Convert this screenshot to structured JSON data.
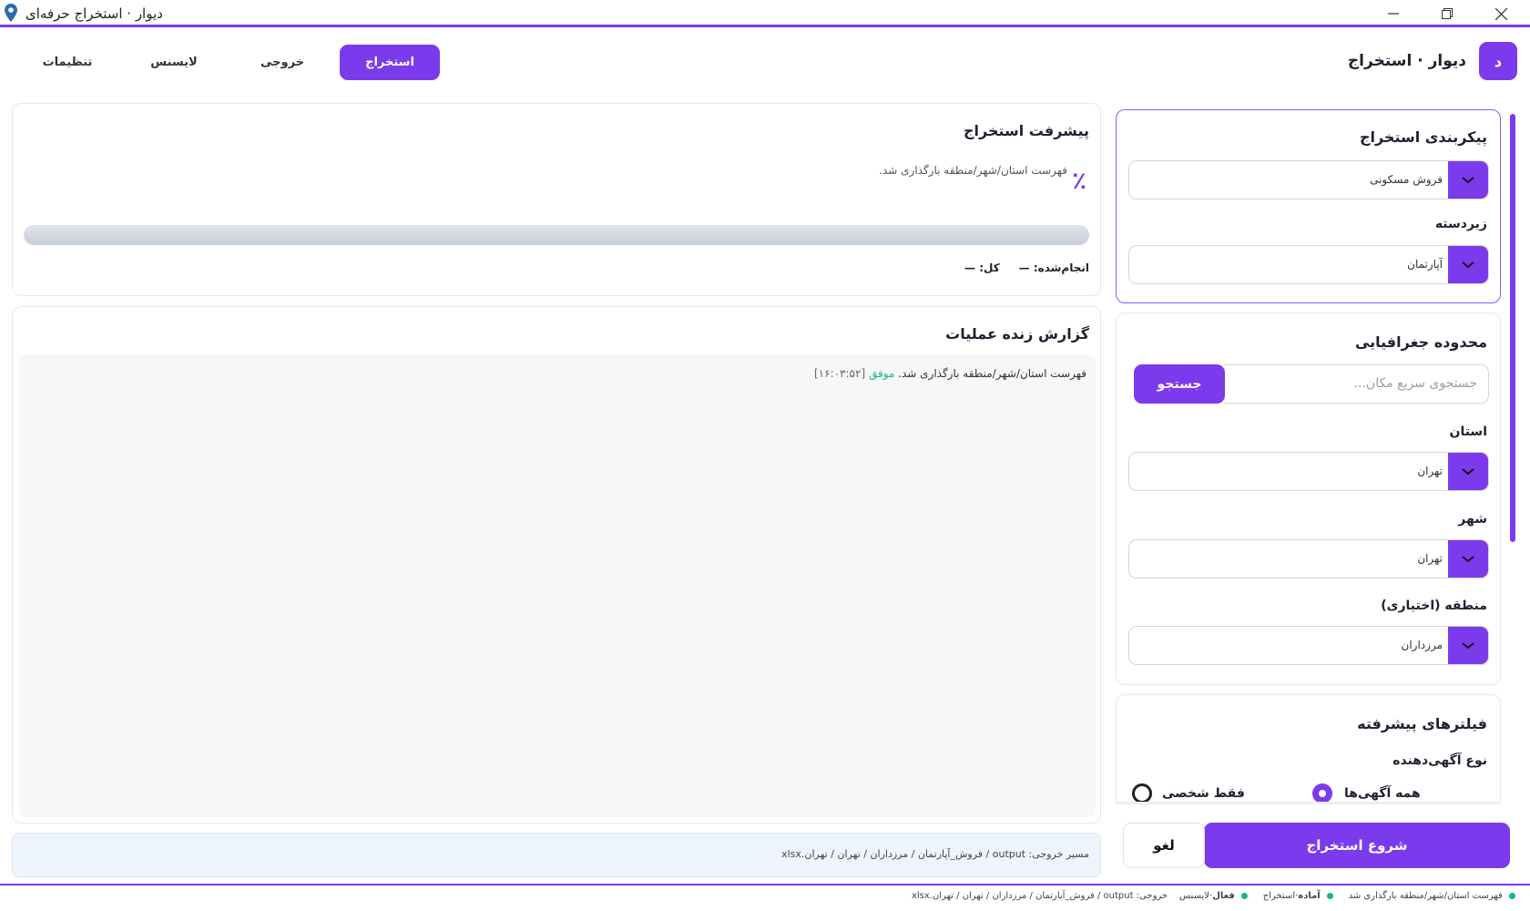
{
  "window": {
    "title": "دیوار · استخراج حرفه‌ای"
  },
  "header": {
    "brand_letter": "د",
    "brand_name": "دیوار · استخراج",
    "tabs": [
      {
        "label": "استخراج",
        "active": true
      },
      {
        "label": "خروجی",
        "active": false
      },
      {
        "label": "لایسنس",
        "active": false
      },
      {
        "label": "تنظیمات",
        "active": false
      }
    ]
  },
  "config": {
    "title": "پیکربندی استخراج",
    "category_value": "فروش مسکونی",
    "subcategory_label": "زیردسته",
    "subcategory_value": "آپارتمان"
  },
  "geo": {
    "title": "محدوده جغرافیایی",
    "search_placeholder": "جستجوی سریع مکان...",
    "search_button": "جستجو",
    "province_label": "استان",
    "province_value": "تهران",
    "city_label": "شهر",
    "city_value": "تهران",
    "region_label": "منطقه (اختیاری)",
    "region_value": "مرزداران"
  },
  "advanced": {
    "title": "فیلترهای پیشرفته",
    "advertiser_label": "نوع آگهی‌دهنده",
    "opt_all": "همه آگهی‌ها",
    "opt_personal": "فقط شخصی",
    "selected": "all"
  },
  "actions": {
    "start": "شروع استخراج",
    "cancel": "لغو"
  },
  "progress": {
    "title": "پیشرفت استخراج",
    "percent": "٪",
    "message": "فهرست استان/شهر/منطقه بارگذاری شد.",
    "done_label": "انجام‌شده:",
    "done_value": "—",
    "total_label": "کل:",
    "total_value": "—",
    "fraction": 0
  },
  "log": {
    "title": "گزارش زنده عملیات",
    "entries": [
      {
        "time": "[۱۶:۰۳:۵۲]",
        "status": "موفق",
        "text": "فهرست استان/شهر/منطقه بارگذاری شد."
      }
    ]
  },
  "output_path": {
    "label": "مسیر خروجی:",
    "path": "output / فروش_آپارتمان / مرزداران / تهران / تهران.xlsx"
  },
  "statusbar": {
    "message": "فهرست استان/شهر/منطقه بارگذاری شد",
    "state_label": "آماده",
    "state_value": "استخراج",
    "license_label": "فعال",
    "license_value": "لایسنس",
    "path": "خروجی: output / فروش_آپارتمان / مرزداران / تهران / تهران.xlsx"
  },
  "colors": {
    "accent": "#7c3aed",
    "success": "#10b981"
  }
}
